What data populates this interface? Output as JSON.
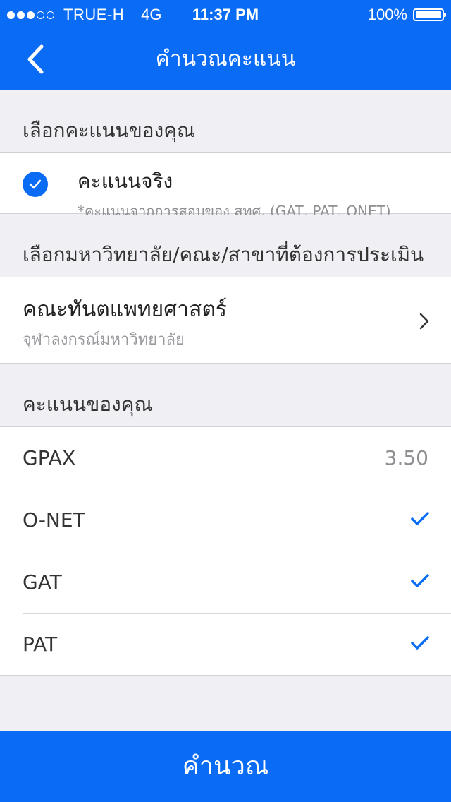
{
  "status_bar": {
    "carrier": "TRUE-H",
    "network": "4G",
    "time": "11:37 PM",
    "battery": "100%",
    "signal_bars_filled": 3,
    "signal_bars_total": 5
  },
  "nav": {
    "title": "คำนวณคะแนน",
    "back_icon": "chevron-left-icon"
  },
  "sections": {
    "choose_score": "เลือกคะแนนของคุณ",
    "choose_university": "เลือกมหาวิทยาลัย/คณะ/สาขาที่ต้องการประเมิน",
    "your_score": "คะแนนของคุณ"
  },
  "score_option": {
    "title": "คะแนนจริง",
    "subtitle": "*คะแนนจากการสอบของ สทศ. (GAT, PAT, ONET)",
    "selected": true
  },
  "faculty": {
    "name": "คณะทันตแพทยศาสตร์",
    "university": "จุฬาลงกรณ์มหาวิทยาลัย"
  },
  "scores": [
    {
      "label": "GPAX",
      "value": "3.50",
      "checked": false
    },
    {
      "label": "O-NET",
      "value": "",
      "checked": true
    },
    {
      "label": "GAT",
      "value": "",
      "checked": true
    },
    {
      "label": "PAT",
      "value": "",
      "checked": true
    }
  ],
  "calculate_button": "คำนวณ",
  "colors": {
    "primary": "#0a6cf5",
    "background": "#efeff4",
    "secondary_text": "#8e8e93"
  }
}
